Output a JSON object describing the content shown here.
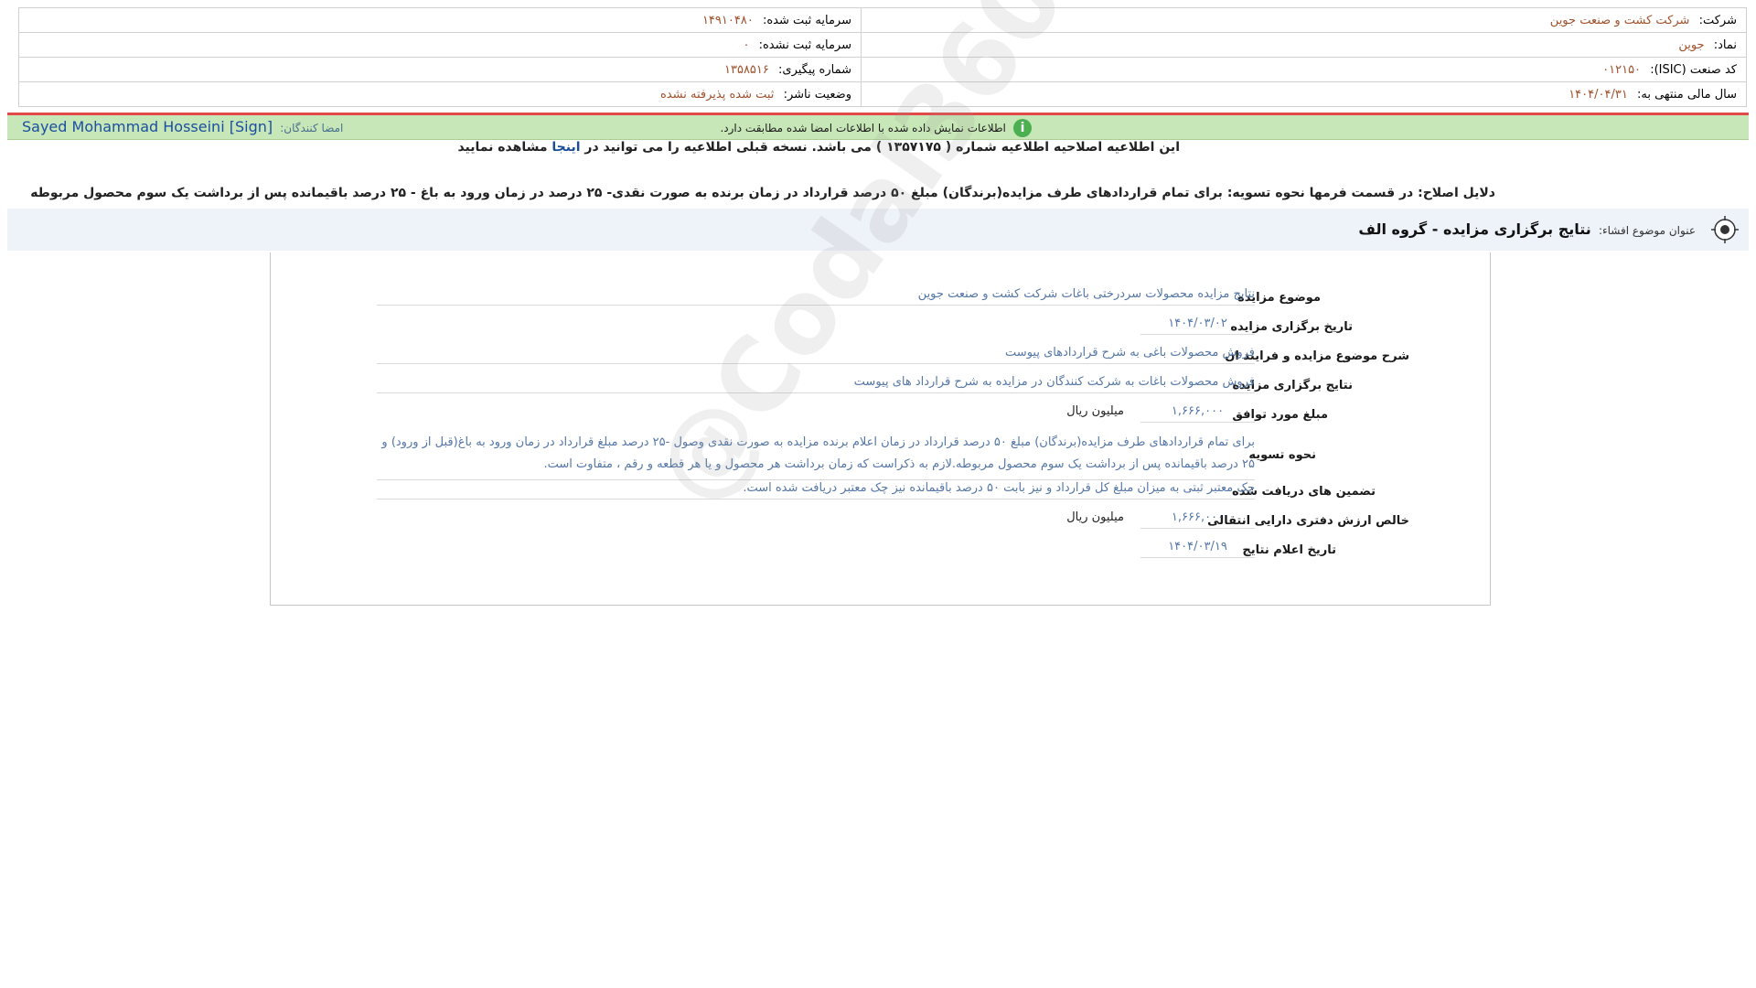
{
  "header": {
    "company_label": "شرکت:",
    "company_value": "شرکت کشت و صنعت جوین",
    "symbol_label": "نماد:",
    "symbol_value": "جوین",
    "isic_label": "کد صنعت (ISIC):",
    "isic_value": "۰۱۲۱۵۰",
    "fiscal_label": "سال مالی منتهی به:",
    "fiscal_value": "۱۴۰۴/۰۴/۳۱",
    "registered_capital_label": "سرمایه ثبت شده:",
    "registered_capital_value": "۱۴۹۱۰۴۸۰",
    "unregistered_capital_label": "سرمایه ثبت نشده:",
    "unregistered_capital_value": "۰",
    "tracking_label": "شماره پیگیری:",
    "tracking_value": "۱۳۵۸۵۱۶",
    "status_label": "وضعیت ناشر:",
    "status_value": "ثبت شده پذیرفته نشده"
  },
  "signature": {
    "label": "امضا کنندگان:",
    "name": "Sayed Mohammad Hosseini [Sign]",
    "match_message": "اطلاعات نمایش داده شده با اطلاعات امضا شده مطابقت دارد.",
    "info_icon": "i"
  },
  "notes": {
    "correction_pre": "این اطلاعیه اصلاحیه اطلاعیه شماره ( ۱۳۵۷۱۷۵ ) می باشد. نسخه قبلی اطلاعیه را می توانید در ",
    "correction_link": "اینجا",
    "correction_post": " مشاهده نمایید",
    "reason": "دلایل اصلاح: در قسمت فرمها نحوه تسویه: برای تمام قراردادهای طرف مزایده(برندگان) مبلغ ۵۰ درصد قرارداد در زمان برنده به صورت نقدی- ۲۵ درصد در زمان ورود به باغ - ۲۵ درصد باقیمانده پس از برداشت یک سوم محصول مربوطه"
  },
  "subject": {
    "label": "عنوان موضوع افشاء:",
    "value": "نتایج برگزاری مزایده - گروه الف"
  },
  "form": {
    "auction_subject_label": "موضوع مزایده",
    "auction_subject_value": "نتایج مزایده محصولات سردرختی باغات شرکت کشت و صنعت جوین",
    "auction_date_label": "تاریخ برگزاری مزایده",
    "auction_date_value": "۱۴۰۴/۰۳/۰۲",
    "description_label": "شرح موضوع مزایده و فرایند ان",
    "description_value": "فروش محصولات باغی به شرح قراردادهای پیوست",
    "results_label": "نتایج برگزاری مزایده",
    "results_value": "فروش محصولات باغات به شرکت کنندگان در مزایده به شرح قرارداد های پیوست",
    "agreed_amount_label": "مبلغ مورد توافق",
    "agreed_amount_value": "۱,۶۶۶,۰۰۰",
    "agreed_amount_unit": "میلیون ریال",
    "settlement_label": "نحوه تسویه",
    "settlement_value": "برای تمام قراردادهای طرف مزایده(برندگان) مبلغ ۵۰ درصد قرارداد در زمان اعلام برنده مزایده به صورت نقدی وصول -۲۵ درصد مبلغ قرارداد در زمان ورود به باغ(قبل از ورود) و ۲۵ درصد باقیمانده پس از برداشت یک سوم محصول مربوطه.لازم به ذکراست که زمان برداشت هر محصول و یا هر قطعه و رقم ، متفاوت است.",
    "guarantees_label": "تضمین های دریافت شده",
    "guarantees_value": "چک معتبر ثبتی به میزان مبلغ کل قرارداد و نیز بابت ۵۰ درصد باقیمانده نیز چک معتبر دریافت شده است.",
    "net_book_value_label": "خالص ارزش دفتری دارایی انتقالی",
    "net_book_value_value": "۱,۶۶۶,۰۰۰",
    "net_book_value_unit": "میلیون ریال",
    "announce_date_label": "تاریخ اعلام نتایج",
    "announce_date_value": "۱۴۰۴/۰۳/۱۹"
  },
  "watermark": "@Codal360.ir"
}
